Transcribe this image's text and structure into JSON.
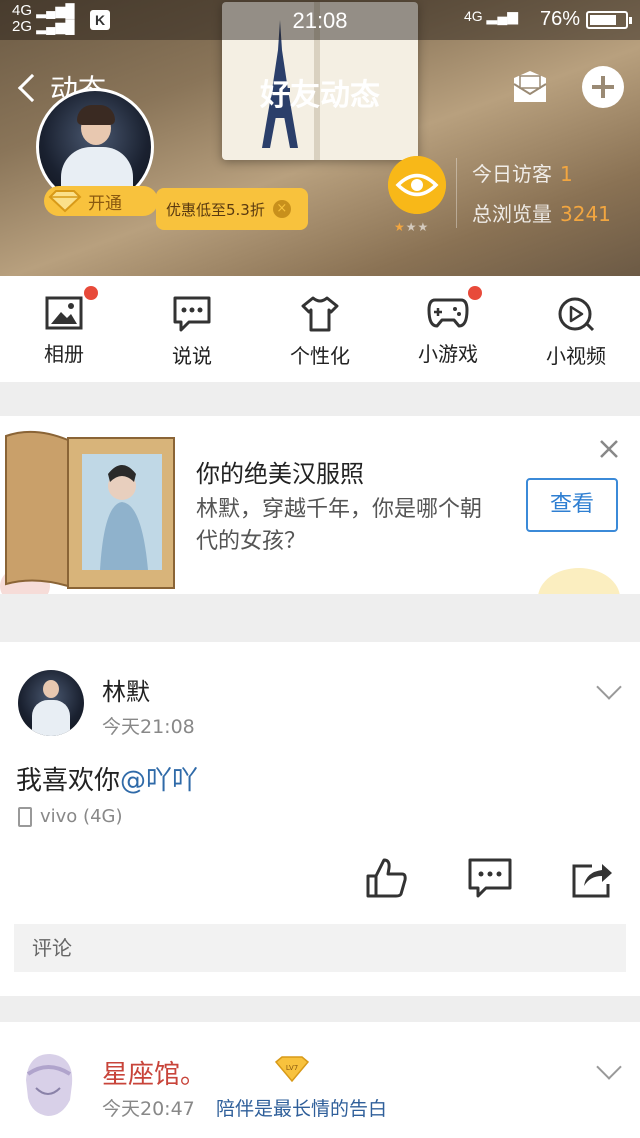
{
  "status_bar": {
    "network_top": "4G",
    "network_bottom": "2G",
    "k_badge": "K",
    "time": "21:08",
    "network_right": "4G",
    "battery": "76%",
    "battery_level": 0.76
  },
  "nav": {
    "back_label": "动态",
    "title": "好友动态"
  },
  "profile": {
    "vip_label": "开通",
    "promo_text": "优惠低至5.3折",
    "visitors_label": "今日访客",
    "visitors_value": "1",
    "views_label": "总浏览量",
    "views_value": "3241",
    "star_rating": 1,
    "star_max": 3
  },
  "shortcuts": [
    {
      "label": "相册",
      "icon": "photo-album-icon",
      "badge": true
    },
    {
      "label": "说说",
      "icon": "chat-bubble-icon",
      "badge": false
    },
    {
      "label": "个性化",
      "icon": "tshirt-icon",
      "badge": false
    },
    {
      "label": "小游戏",
      "icon": "gamepad-icon",
      "badge": true
    },
    {
      "label": "小视频",
      "icon": "video-play-icon",
      "badge": false
    }
  ],
  "ad": {
    "title": "你的绝美汉服照",
    "subtitle": "林默，穿越千年，你是哪个朝代的女孩？",
    "button": "查看"
  },
  "post": {
    "name": "林默",
    "time": "今天21:08",
    "text": "我喜欢你",
    "mention": "@吖吖",
    "device": "vivo (4G)",
    "comment_placeholder": "评论"
  },
  "post2": {
    "name": "星座馆。",
    "level_badge": "LV7",
    "time": "今天20:47",
    "signature": "陪伴是最长情的告白"
  },
  "colors": {
    "accent_blue": "#2f7fd2",
    "badge_red": "#e84a3a",
    "vip_yellow": "#f8c23d",
    "mention_blue": "#2f6aa8",
    "name_red": "#c8443a"
  }
}
